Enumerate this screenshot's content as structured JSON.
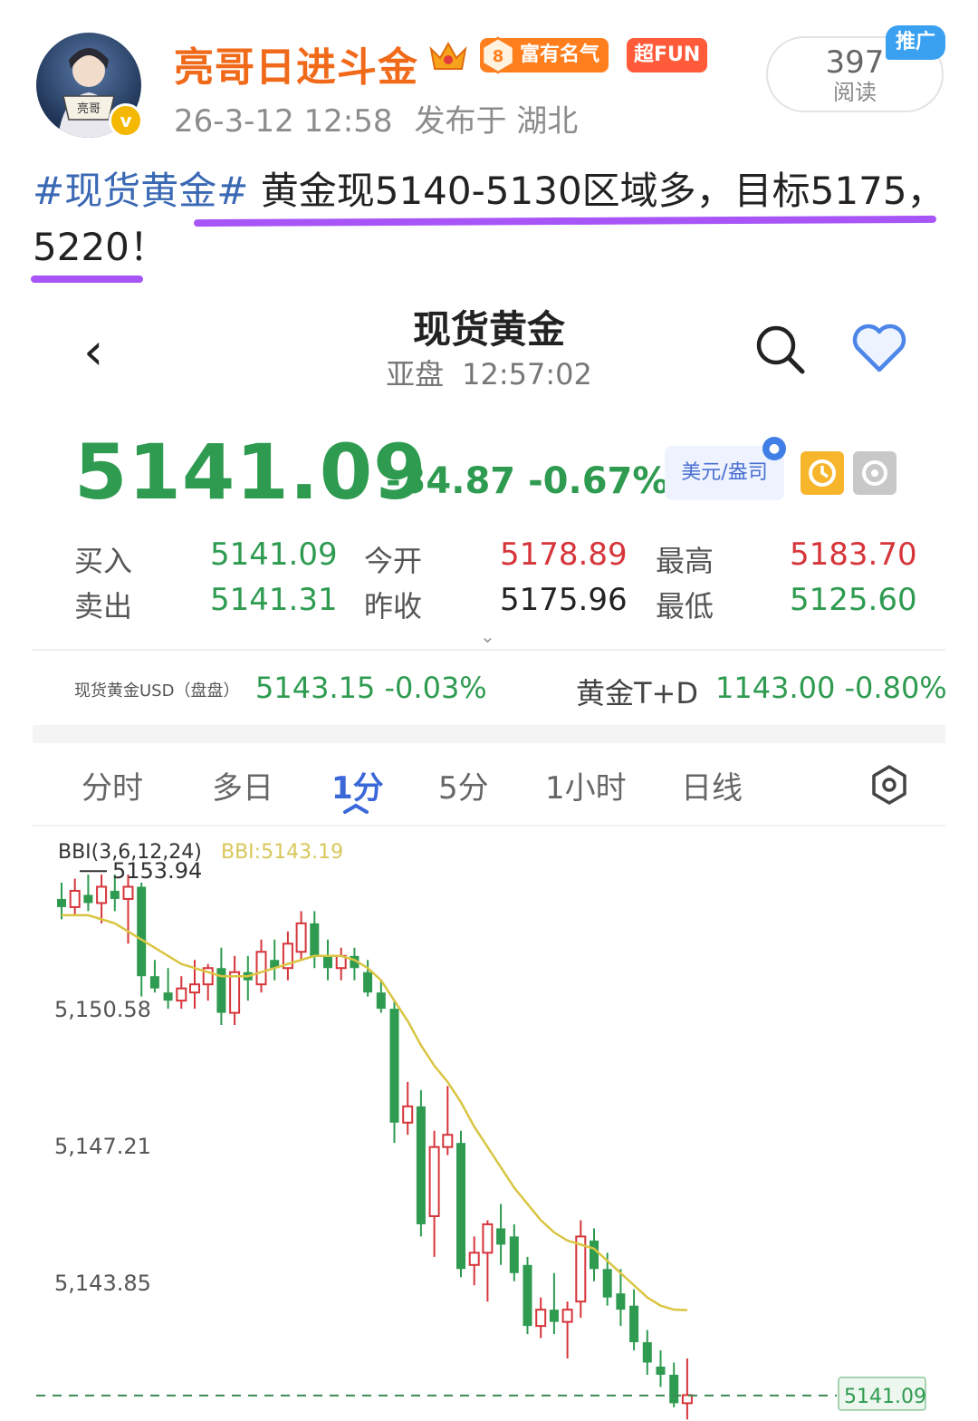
{
  "post": {
    "username": "亮哥日进斗金",
    "badge_level": "8",
    "badge_fame": "富有名气",
    "badge_fun": "超FUN",
    "timestamp": "26-3-12 12:58",
    "location": "发布于 湖北",
    "reads_count": "397",
    "reads_label": "阅读",
    "promo_label": "推广",
    "avatar_text": "亮哥",
    "verified_mark": "v",
    "hashtag": "#现货黄金#",
    "text": " 黄金现5140-5130区域多，目标5175，5220！"
  },
  "app": {
    "title": "现货黄金",
    "session": "亚盘",
    "time": "12:57:02",
    "price": "5141.09",
    "change": "-34.87",
    "change_pct": "-0.67%",
    "unit": "美元/盎司",
    "colors": {
      "down": "#2e9b50",
      "up": "#d6353a",
      "accent": "#3a68d8"
    },
    "quotes": {
      "buy_label": "买入",
      "buy": "5141.09",
      "sell_label": "卖出",
      "sell": "5141.31",
      "open_label": "今开",
      "open": "5178.89",
      "prev_label": "昨收",
      "prev": "5175.96",
      "high_label": "最高",
      "high": "5183.70",
      "low_label": "最低",
      "low": "5125.60"
    },
    "related": [
      {
        "name": "现货黄金USD（盘盘）",
        "value": "5143.15 -0.03%"
      },
      {
        "name": "黄金T+D",
        "value": "1143.00 -0.80%"
      }
    ],
    "tabs": [
      "分时",
      "多日",
      "1分",
      "5分",
      "1小时",
      "日线"
    ],
    "active_tab": "1分"
  },
  "chart_data": {
    "type": "candlestick",
    "indicator_label": "BBI(3,6,12,24)",
    "indicator_value": "BBI:5143.19",
    "max_marker": "5153.94",
    "last_price_tag": "5141.09",
    "y_ticks": [
      "5,150.58",
      "5,147.21",
      "5,143.85"
    ],
    "y_tick_values": [
      5150.58,
      5147.21,
      5143.85
    ],
    "candles": [
      [
        5153.3,
        5153.7,
        5152.8,
        5153.1
      ],
      [
        5153.1,
        5153.8,
        5152.9,
        5153.5
      ],
      [
        5153.4,
        5153.9,
        5153.0,
        5153.2
      ],
      [
        5153.2,
        5153.9,
        5152.7,
        5153.6
      ],
      [
        5153.5,
        5153.9,
        5153.0,
        5153.3
      ],
      [
        5153.3,
        5153.9,
        5152.2,
        5153.6
      ],
      [
        5153.6,
        5153.7,
        5150.9,
        5151.4
      ],
      [
        5151.4,
        5151.8,
        5151.0,
        5151.1
      ],
      [
        5151.0,
        5151.6,
        5150.6,
        5150.8
      ],
      [
        5150.8,
        5151.4,
        5150.6,
        5151.1
      ],
      [
        5151.0,
        5151.8,
        5150.6,
        5151.2
      ],
      [
        5151.2,
        5151.7,
        5150.8,
        5151.6
      ],
      [
        5151.6,
        5152.1,
        5150.2,
        5150.5
      ],
      [
        5150.5,
        5151.9,
        5150.2,
        5151.5
      ],
      [
        5151.5,
        5151.9,
        5150.8,
        5151.3
      ],
      [
        5151.2,
        5152.3,
        5151.0,
        5152.0
      ],
      [
        5151.8,
        5152.3,
        5151.3,
        5151.6
      ],
      [
        5151.6,
        5152.5,
        5151.3,
        5152.2
      ],
      [
        5152.0,
        5153.0,
        5151.8,
        5152.7
      ],
      [
        5152.7,
        5153.0,
        5151.6,
        5151.9
      ],
      [
        5151.9,
        5152.3,
        5151.3,
        5151.6
      ],
      [
        5151.6,
        5152.1,
        5151.3,
        5151.9
      ],
      [
        5151.9,
        5152.1,
        5151.3,
        5151.6
      ],
      [
        5151.5,
        5151.8,
        5150.9,
        5151.0
      ],
      [
        5151.0,
        5151.3,
        5150.5,
        5150.6
      ],
      [
        5150.6,
        5150.8,
        5147.3,
        5147.8
      ],
      [
        5147.8,
        5148.8,
        5147.5,
        5148.2
      ],
      [
        5148.2,
        5148.6,
        5145.0,
        5145.3
      ],
      [
        5145.5,
        5147.6,
        5144.5,
        5147.2
      ],
      [
        5147.2,
        5148.7,
        5147.0,
        5147.5
      ],
      [
        5147.3,
        5147.6,
        5144.0,
        5144.2
      ],
      [
        5144.3,
        5145.0,
        5143.8,
        5144.6
      ],
      [
        5144.6,
        5145.4,
        5143.4,
        5145.3
      ],
      [
        5145.2,
        5145.8,
        5144.3,
        5144.8
      ],
      [
        5145.0,
        5145.3,
        5143.9,
        5144.1
      ],
      [
        5144.3,
        5144.5,
        5142.6,
        5142.8
      ],
      [
        5142.8,
        5143.5,
        5142.5,
        5143.2
      ],
      [
        5143.2,
        5144.1,
        5142.6,
        5142.9
      ],
      [
        5142.9,
        5143.4,
        5142.0,
        5143.2
      ],
      [
        5143.4,
        5145.4,
        5143.0,
        5145.0
      ],
      [
        5144.9,
        5145.2,
        5143.9,
        5144.2
      ],
      [
        5144.2,
        5144.6,
        5143.3,
        5143.5
      ],
      [
        5143.6,
        5144.2,
        5142.8,
        5143.2
      ],
      [
        5143.3,
        5143.7,
        5142.2,
        5142.4
      ],
      [
        5142.4,
        5142.7,
        5141.6,
        5141.9
      ],
      [
        5141.8,
        5142.2,
        5141.3,
        5141.6
      ],
      [
        5141.6,
        5141.9,
        5140.8,
        5140.9
      ],
      [
        5140.9,
        5142.0,
        5140.5,
        5141.1
      ]
    ],
    "bbi_line": [
      5152.9,
      5152.9,
      5152.9,
      5152.8,
      5152.7,
      5152.5,
      5152.3,
      5152.1,
      5151.9,
      5151.7,
      5151.6,
      5151.5,
      5151.4,
      5151.4,
      5151.4,
      5151.5,
      5151.6,
      5151.7,
      5151.8,
      5151.9,
      5151.9,
      5151.9,
      5151.8,
      5151.6,
      5151.3,
      5150.8,
      5150.3,
      5149.7,
      5149.2,
      5148.8,
      5148.3,
      5147.7,
      5147.2,
      5146.7,
      5146.2,
      5145.8,
      5145.4,
      5145.1,
      5144.9,
      5144.8,
      5144.7,
      5144.4,
      5144.1,
      5143.8,
      5143.5,
      5143.3,
      5143.2,
      5143.19
    ]
  }
}
